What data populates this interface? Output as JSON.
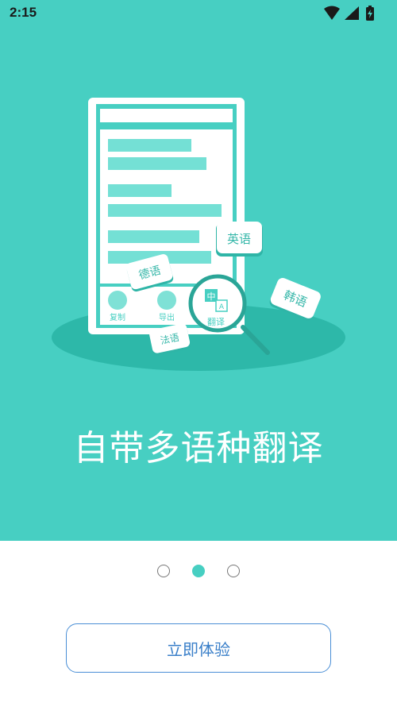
{
  "status_bar": {
    "time": "2:15"
  },
  "illustration": {
    "doc_buttons": [
      "复制",
      "导出",
      "翻译"
    ],
    "translate_badge": {
      "top": "中",
      "bottom": "A"
    },
    "language_tags": [
      "英语",
      "德语",
      "韩语",
      "法语"
    ]
  },
  "headline": "自带多语种翻译",
  "pager": {
    "count": 3,
    "active_index": 1
  },
  "cta": {
    "label": "立即体验"
  },
  "colors": {
    "primary": "#47cfc2",
    "button_border": "#4a8fd6",
    "button_text": "#3a7fc9"
  }
}
